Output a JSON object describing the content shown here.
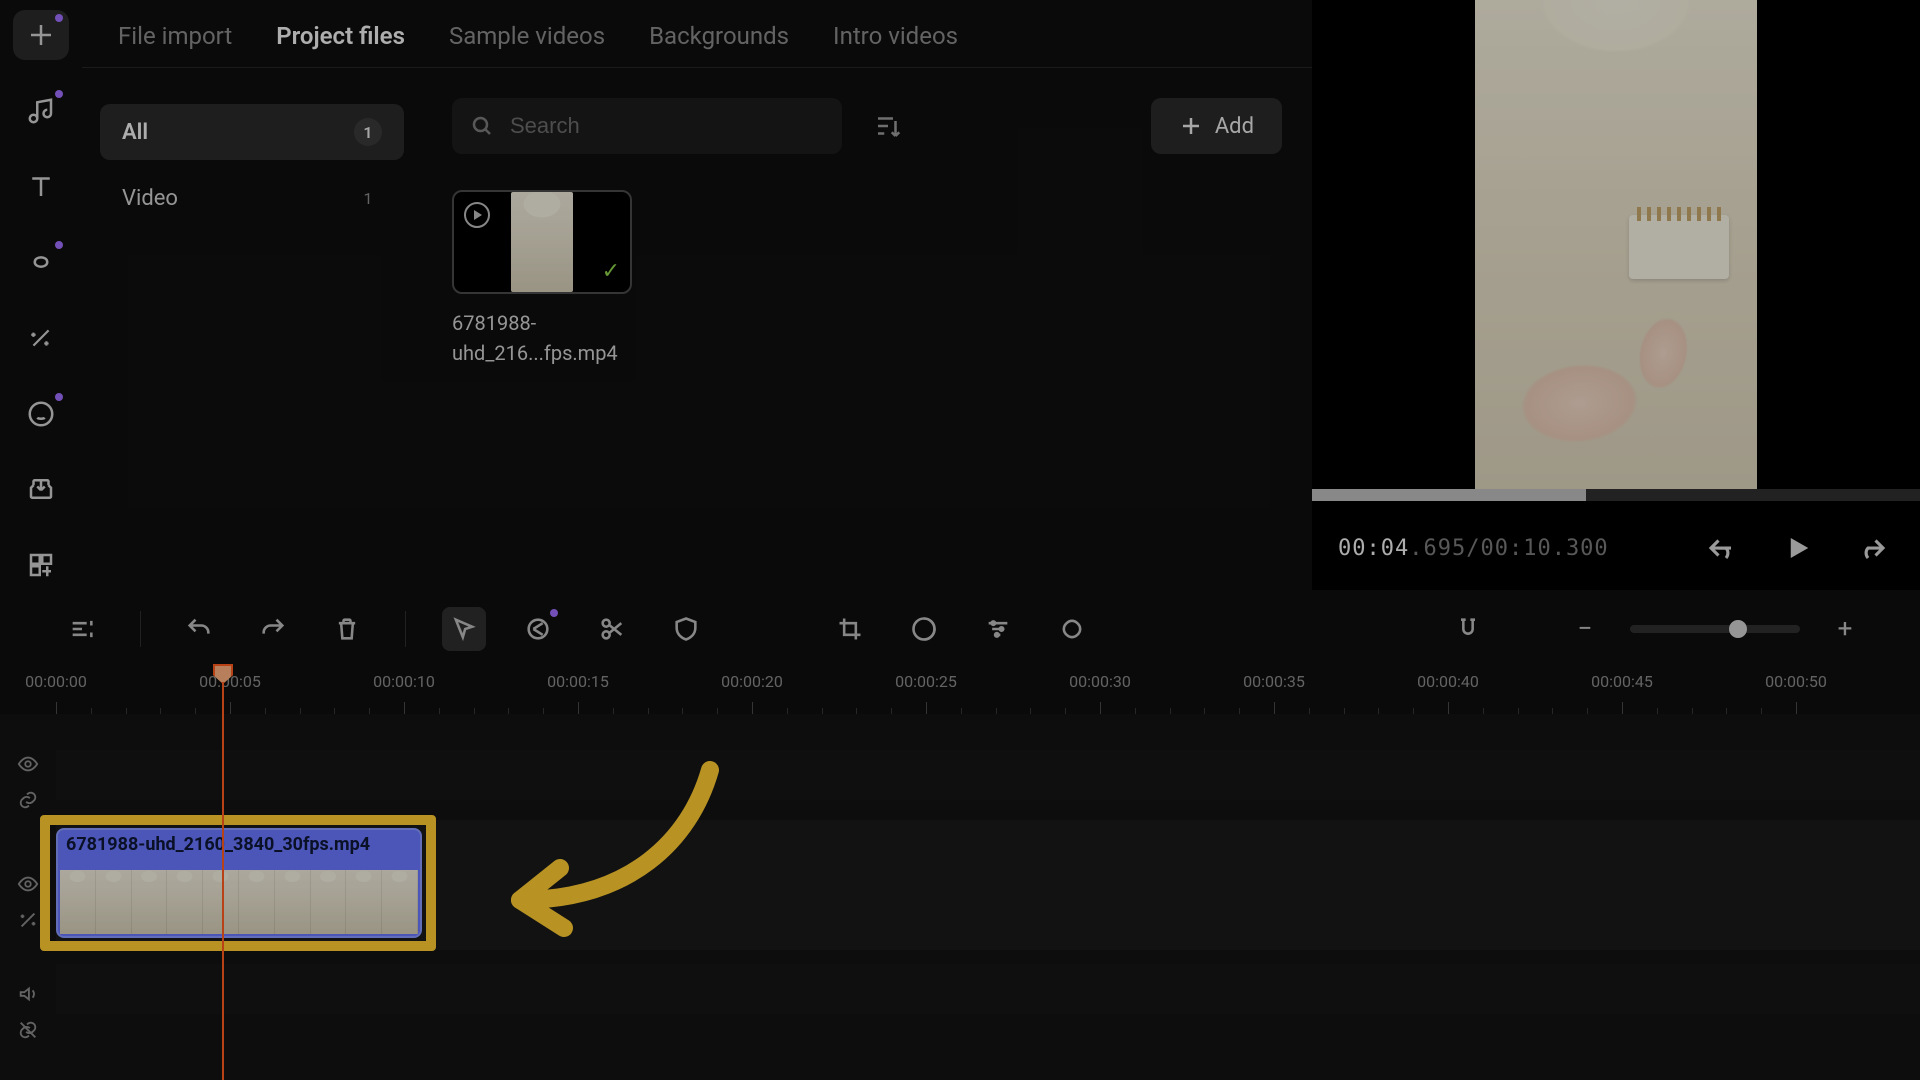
{
  "rail": {
    "items": [
      {
        "name": "add",
        "hasDot": false
      },
      {
        "name": "music",
        "hasDot": true
      },
      {
        "name": "text",
        "hasDot": false
      },
      {
        "name": "transition",
        "hasDot": true
      },
      {
        "name": "magic",
        "hasDot": false
      },
      {
        "name": "sticker",
        "hasDot": true
      },
      {
        "name": "export",
        "hasDot": false
      },
      {
        "name": "templates",
        "hasDot": false
      }
    ]
  },
  "tabs": {
    "items": [
      "File import",
      "Project files",
      "Sample videos",
      "Backgrounds",
      "Intro videos"
    ],
    "active": 1
  },
  "filters": {
    "items": [
      {
        "label": "All",
        "count": "1",
        "active": true
      },
      {
        "label": "Video",
        "count": "1",
        "active": false
      }
    ]
  },
  "search": {
    "placeholder": "Search"
  },
  "add_button": {
    "label": "Add"
  },
  "files": {
    "items": [
      {
        "name": "6781988-uhd_216...fps.mp4"
      }
    ]
  },
  "preview": {
    "current_time": "00:04",
    "current_ms": ".695",
    "sep": "/",
    "total": "00:10.300"
  },
  "ruler": {
    "labels": [
      "00:00:00",
      "00:00:05",
      "00:00:10",
      "00:00:15",
      "00:00:20",
      "00:00:25",
      "00:00:30",
      "00:00:35",
      "00:00:40",
      "00:00:45",
      "00:00:50"
    ]
  },
  "clip": {
    "title": "6781988-uhd_2160_3840_30fps.mp4"
  }
}
